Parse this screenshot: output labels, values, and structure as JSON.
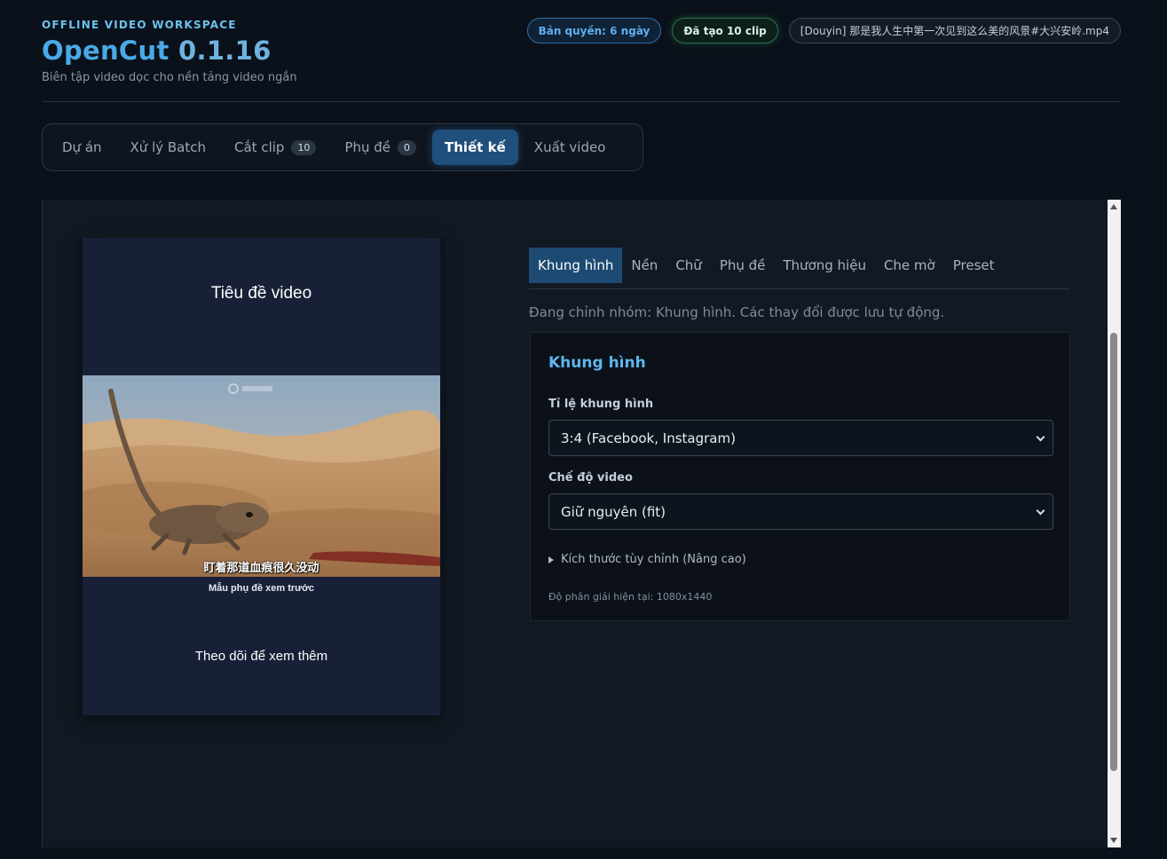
{
  "header": {
    "eyebrow": "OFFLINE VIDEO WORKSPACE",
    "app_name": "OpenCut",
    "version": "0.1.16",
    "tagline": "Biên tập video dọc cho nền tảng video ngắn",
    "badges": {
      "license": "Bản quyền: 6 ngày",
      "trained": "Đã tạo 10 clip",
      "file": "[Douyin] 那是我人生中第一次见到这么美的风景#大兴安岭.mp4"
    }
  },
  "tabs": [
    {
      "label": "Dự án"
    },
    {
      "label": "Xử lý Batch"
    },
    {
      "label": "Cắt clip",
      "count": "10"
    },
    {
      "label": "Phụ đề",
      "count": "0"
    },
    {
      "label": "Thiết kế",
      "active": true
    },
    {
      "label": "Xuất video"
    }
  ],
  "preview": {
    "title": "Tiêu đề video",
    "overlay_subtitle": "盯着那道血痕很久没动",
    "sample_subtitle": "Mẫu phụ đề xem trước",
    "footer": "Theo dõi để xem thêm"
  },
  "design": {
    "sub_tabs": [
      "Khung hình",
      "Nền",
      "Chữ",
      "Phụ đề",
      "Thương hiệu",
      "Che mờ",
      "Preset"
    ],
    "active_sub_tab": "Khung hình",
    "status_note": "Đang chỉnh nhóm: Khung hình. Các thay đổi được lưu tự động.",
    "panel": {
      "title": "Khung hình",
      "aspect_label": "Tỉ lệ khung hình",
      "aspect_value": "3:4 (Facebook, Instagram)",
      "mode_label": "Chế độ video",
      "mode_value": "Giữ nguyên (fit)",
      "advanced_label": "Kích thước tùy chỉnh (Nâng cao)",
      "resolution_text": "Độ phân giải hiện tại: 1080x1440"
    }
  },
  "colors": {
    "accent": "#4aa9e6",
    "active_tab": "#1f4f7c",
    "background": "#0b111a"
  }
}
